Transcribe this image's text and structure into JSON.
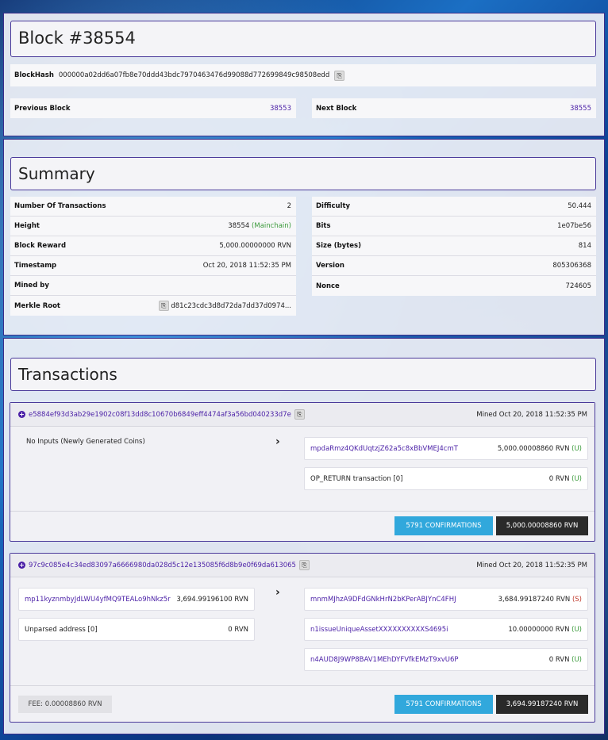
{
  "block": {
    "title": "Block #38554",
    "hash_label": "BlockHash",
    "hash": "000000a02dd6a07fb8e70ddd43bdc7970463476d99088d772699849c98508edd",
    "prev_label": "Previous Block",
    "prev_value": "38553",
    "next_label": "Next Block",
    "next_value": "38555"
  },
  "summary": {
    "title": "Summary",
    "left": [
      {
        "label": "Number Of Transactions",
        "value": "2"
      },
      {
        "label": "Height",
        "value": "38554",
        "extra": "(Mainchain)"
      },
      {
        "label": "Block Reward",
        "value": "5,000.00000000 RVN"
      },
      {
        "label": "Timestamp",
        "value": "Oct 20, 2018 11:52:35 PM"
      },
      {
        "label": "Mined by",
        "value": ""
      },
      {
        "label": "Merkle Root",
        "value": "d81c23cdc3d8d72da7dd37d0974..."
      }
    ],
    "right": [
      {
        "label": "Difficulty",
        "value": "50.444"
      },
      {
        "label": "Bits",
        "value": "1e07be56"
      },
      {
        "label": "Size (bytes)",
        "value": "814"
      },
      {
        "label": "Version",
        "value": "805306368"
      },
      {
        "label": "Nonce",
        "value": "724605"
      }
    ]
  },
  "transactions": {
    "title": "Transactions",
    "items": [
      {
        "txid": "e5884ef93d3ab29e1902c08f13dd8c10670b6849eff4474af3a56bd040233d7e",
        "mined": "Mined Oct 20, 2018 11:52:35 PM",
        "inputs_text": "No Inputs (Newly Generated Coins)",
        "outputs": [
          {
            "address": "mpdaRmz4QKdUqtzjZ62a5c8xBbVMEJ4cmT",
            "amount": "5,000.00008860 RVN",
            "flag": "(U)"
          },
          {
            "address": "OP_RETURN transaction [0]",
            "amount": "0 RVN",
            "flag": "(U)"
          }
        ],
        "confirmations": "5791 CONFIRMATIONS",
        "total": "5,000.00008860 RVN"
      },
      {
        "txid": "97c9c085e4c34ed83097a6666980da028d5c12e135085f6d8b9e0f69da613065",
        "mined": "Mined Oct 20, 2018 11:52:35 PM",
        "inputs": [
          {
            "address": "mp11kyznmbyJdLWU4yfMQ9TEALo9hNkz5r",
            "amount": "3,694.99196100 RVN"
          },
          {
            "address": "Unparsed address [0]",
            "amount": "0 RVN"
          }
        ],
        "outputs": [
          {
            "address": "mnmMJhzA9DFdGNkHrN2bKPerABJYnC4FHJ",
            "amount": "3,684.99187240 RVN",
            "flag": "(S)"
          },
          {
            "address": "n1issueUniqueAssetXXXXXXXXXXS4695i",
            "amount": "10.00000000 RVN",
            "flag": "(U)"
          },
          {
            "address": "n4AUD8J9WP8BAV1MEhDYFVfkEMzT9xvU6P",
            "amount": "0 RVN",
            "flag": "(U)"
          }
        ],
        "fee": "FEE: 0.00008860 RVN",
        "confirmations": "5791 CONFIRMATIONS",
        "total": "3,694.99187240 RVN"
      }
    ]
  },
  "colors": {
    "link": "#4a1fa6",
    "confirm": "#31a8dc",
    "total": "#2a2a2a",
    "unspent": "#3a9a3a",
    "spent": "#c0392b"
  },
  "icons": {
    "copy": "copy-icon",
    "expand": "plus-circle-icon",
    "arrow": "chevron-right-icon"
  }
}
